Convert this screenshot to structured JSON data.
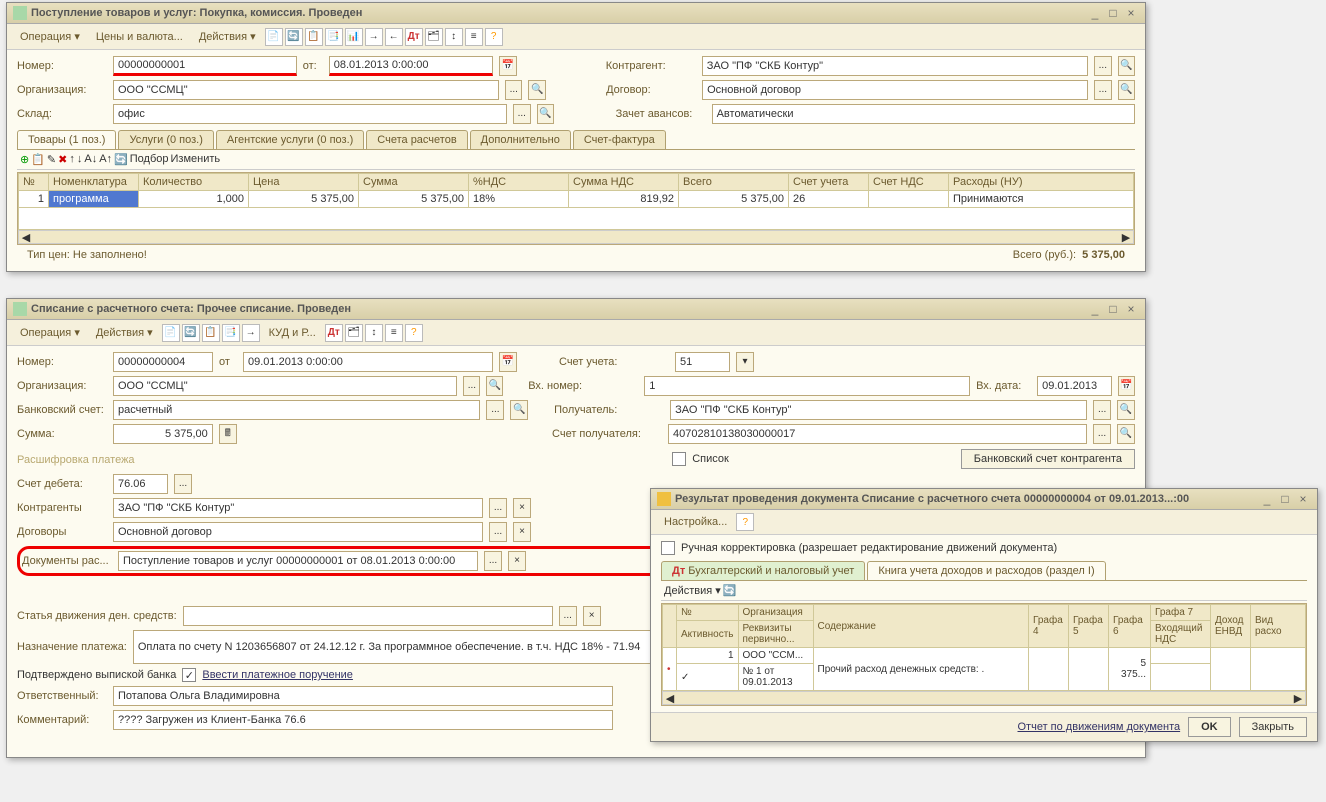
{
  "win1": {
    "title": "Поступление товаров и услуг: Покупка, комиссия. Проведен",
    "toolbar": {
      "operation": "Операция ▾",
      "prices": "Цены и валюта...",
      "actions": "Действия ▾"
    },
    "fields": {
      "number_label": "Номер:",
      "number": "00000000001",
      "date_label": "от:",
      "date": "08.01.2013 0:00:00",
      "org_label": "Организация:",
      "org": "ООО \"ССМЦ\"",
      "warehouse_label": "Склад:",
      "warehouse": "офис",
      "counterparty_label": "Контрагент:",
      "counterparty": "ЗАО \"ПФ \"СКБ Контур\"",
      "contract_label": "Договор:",
      "contract": "Основной договор",
      "advances_label": "Зачет авансов:",
      "advances": "Автоматически"
    },
    "tabs": {
      "goods": "Товары (1 поз.)",
      "services": "Услуги (0 поз.)",
      "agent": "Агентские услуги (0 поз.)",
      "accounts": "Счета расчетов",
      "extra": "Дополнительно",
      "invoice": "Счет-фактура"
    },
    "grid_toolbar": {
      "select": "Подбор",
      "edit": "Изменить"
    },
    "grid": {
      "headers": {
        "n": "№",
        "nom": "Номенклатура",
        "qty": "Количество",
        "price": "Цена",
        "sum": "Сумма",
        "vat_rate": "%НДС",
        "vat_sum": "Сумма НДС",
        "total": "Всего",
        "acct": "Счет учета",
        "vat_acct": "Счет НДС",
        "expenses": "Расходы (НУ)"
      },
      "row": {
        "n": "1",
        "nom": "программа",
        "qty": "1,000",
        "price": "5 375,00",
        "sum": "5 375,00",
        "vat_rate": "18%",
        "vat_sum": "819,92",
        "total": "5 375,00",
        "acct": "26",
        "vat_acct": "",
        "expenses": "Принимаются"
      }
    },
    "footer": {
      "price_type_label": "Тип цен: Не заполнено!",
      "total_label": "Всего (руб.):",
      "total": "5 375,00"
    }
  },
  "win2": {
    "title": "Списание с расчетного счета: Прочее списание. Проведен",
    "toolbar": {
      "operation": "Операция ▾",
      "actions": "Действия ▾",
      "kudp": "КУД и Р..."
    },
    "fields": {
      "number_label": "Номер:",
      "number": "00000000004",
      "date_label": "от",
      "date": "09.01.2013 0:00:00",
      "org_label": "Организация:",
      "org": "ООО \"ССМЦ\"",
      "bank_acct_label": "Банковский счет:",
      "bank_acct": "расчетный",
      "amount_label": "Сумма:",
      "amount": "5 375,00",
      "account_label": "Счет учета:",
      "account": "51",
      "ext_num_label": "Вх. номер:",
      "ext_num": "1",
      "ext_date_label": "Вх. дата:",
      "ext_date": "09.01.2013",
      "recipient_label": "Получатель:",
      "recipient": "ЗАО \"ПФ \"СКБ Контур\"",
      "recip_acct_label": "Счет получателя:",
      "recip_acct": "40702810138030000017",
      "list_label": "Список",
      "bank_acct_btn": "Банковский счет контрагента"
    },
    "section": "Расшифровка платежа",
    "details": {
      "debit_label": "Счет дебета:",
      "debit": "76.06",
      "counterparty_label": "Контрагенты",
      "counterparty": "ЗАО \"ПФ \"СКБ Контур\"",
      "contract_label": "Договоры",
      "contract": "Основной договор",
      "docs_label": "Документы рас...",
      "docs": "Поступление товаров и услуг 00000000001 от 08.01.2013 0:00:00",
      "movement_label": "Статья движения ден. средств:",
      "purpose_label": "Назначение платежа:",
      "purpose": "Оплата по счету N 1203656807 от 24.12.12 г. За программное обеспечение. в т.ч. НДС 18% - 71.94",
      "confirmed_label": "Подтверждено выпиской банка",
      "enter_order": "Ввести платежное поручение",
      "responsible_label": "Ответственный:",
      "responsible": "Потапова Ольга Владимировна",
      "comment_label": "Комментарий:",
      "comment": "???? Загружен из Клиент-Банка 76.6"
    }
  },
  "win3": {
    "title": "Результат проведения документа Списание с расчетного счета 00000000004 от 09.01.2013...:00",
    "settings": "Настройка...",
    "manual_label": "Ручная корректировка (разрешает редактирование движений документа)",
    "tabs": {
      "accounting": "Бухгалтерский и налоговый учет",
      "book": "Книга учета доходов и расходов (раздел I)"
    },
    "actions": "Действия ▾",
    "grid": {
      "headers": {
        "n": "№",
        "activity": "Активность",
        "org": "Организация",
        "req": "Реквизиты первично...",
        "content": "Содержание",
        "g4": "Графа 4",
        "g5": "Графа 5",
        "g6": "Графа 6",
        "g7": "Графа 7",
        "vat_in": "Входящий НДС",
        "envd": "Доход ЕНВД",
        "expense_type": "Вид расхо"
      },
      "row": {
        "n": "1",
        "org": "ООО \"ССМ...",
        "req": "№ 1 от 09.01.2013",
        "content": "Прочий расход денежных средств: .",
        "g6": "5 375..."
      }
    },
    "footer": {
      "report": "Отчет по движениям документа",
      "ok": "OK",
      "close": "Закрыть"
    }
  }
}
